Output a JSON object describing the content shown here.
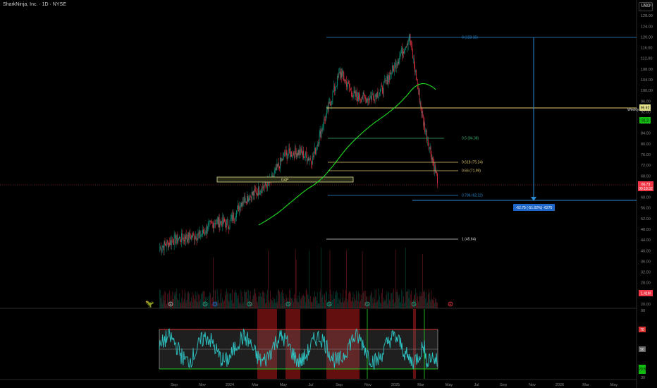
{
  "header": {
    "symbol_title": "SharkNinja, Inc. · 1D · NYSE",
    "currency": "USD"
  },
  "price_axis": {
    "ticks": [
      "132.00",
      "128.00",
      "124.00",
      "120.00",
      "116.00",
      "112.00",
      "108.00",
      "104.00",
      "100.00",
      "96.00",
      "92.00",
      "88.00",
      "84.00",
      "80.00",
      "76.00",
      "72.00",
      "68.00",
      "64.00",
      "60.00",
      "56.00",
      "52.00",
      "48.00",
      "44.00",
      "40.00",
      "36.00",
      "32.00",
      "28.00",
      "24.00",
      "20.00"
    ],
    "weekly_label": "Weekly",
    "weekly_value": "95.92",
    "green_value": "91.3",
    "last_price": "66.73",
    "countdown": "09:18:32",
    "volume_label": "1.41M"
  },
  "rsi_axis": {
    "ticks": [
      "90",
      "70",
      "50",
      "30"
    ],
    "upper_value": "70",
    "mid_value": "50",
    "lower_value": "30",
    "current_value": "23.5"
  },
  "time_axis": {
    "ticks": [
      "Sep",
      "Nov",
      "2024",
      "Mar",
      "May",
      "Jul",
      "Sep",
      "Nov",
      "2025",
      "Mar",
      "May",
      "Jul",
      "Sep",
      "Nov",
      "2026",
      "Mar",
      "May"
    ]
  },
  "fib_levels": {
    "level_0": "0 (123.15)",
    "level_05": "0.5 (84.38)",
    "level_0618": "0.618 (75.24)",
    "level_066": "0.66 (71.99)",
    "level_0786": "0.786 (62.22)",
    "level_1": "1 (45.64)"
  },
  "annotations": {
    "gap_label": "GAP",
    "measure_label": "-62.75 (-51.02%) -6275"
  },
  "events": {
    "earnings": "E",
    "dividend": "D",
    "split": "S"
  },
  "colors": {
    "background": "#000000",
    "fib_blue": "#2a8bd6",
    "fib_green": "#3bb273",
    "fib_yellow": "#e2c86b",
    "candle_green": "#089981",
    "candle_red": "#f23645",
    "ma_green": "#22dd22",
    "rsi_line": "#2ec4c4",
    "rsi_band": "#5a5a5a",
    "overbought": "#b71c1c"
  },
  "chart_data": {
    "type": "candlestick",
    "title": "SharkNinja, Inc. · 1D · NYSE",
    "x_range": [
      "2023-08",
      "2026-05"
    ],
    "ylim": [
      20,
      136
    ],
    "y_scale": "linear",
    "close_path": [
      {
        "date": "2023-08",
        "close": 41
      },
      {
        "date": "2023-09",
        "close": 44
      },
      {
        "date": "2023-10",
        "close": 45
      },
      {
        "date": "2023-11",
        "close": 46
      },
      {
        "date": "2023-12",
        "close": 51
      },
      {
        "date": "2024-01",
        "close": 50
      },
      {
        "date": "2024-02",
        "close": 59
      },
      {
        "date": "2024-03",
        "close": 62
      },
      {
        "date": "2024-04",
        "close": 66
      },
      {
        "date": "2024-05",
        "close": 76
      },
      {
        "date": "2024-06",
        "close": 77
      },
      {
        "date": "2024-07",
        "close": 74
      },
      {
        "date": "2024-08",
        "close": 91
      },
      {
        "date": "2024-09",
        "close": 107
      },
      {
        "date": "2024-10",
        "close": 98
      },
      {
        "date": "2024-11",
        "close": 97
      },
      {
        "date": "2024-12",
        "close": 100
      },
      {
        "date": "2025-01",
        "close": 110
      },
      {
        "date": "2025-02",
        "close": 120
      },
      {
        "date": "2025-03",
        "close": 88
      },
      {
        "date": "2025-04",
        "close": 66.73
      }
    ],
    "fib_retracement": {
      "from": 123.15,
      "to": 45.64
    },
    "horizontal_lines": [
      95.92,
      60.4
    ],
    "rsi": {
      "overbought": 70,
      "oversold": 30,
      "last": 23.5
    }
  }
}
